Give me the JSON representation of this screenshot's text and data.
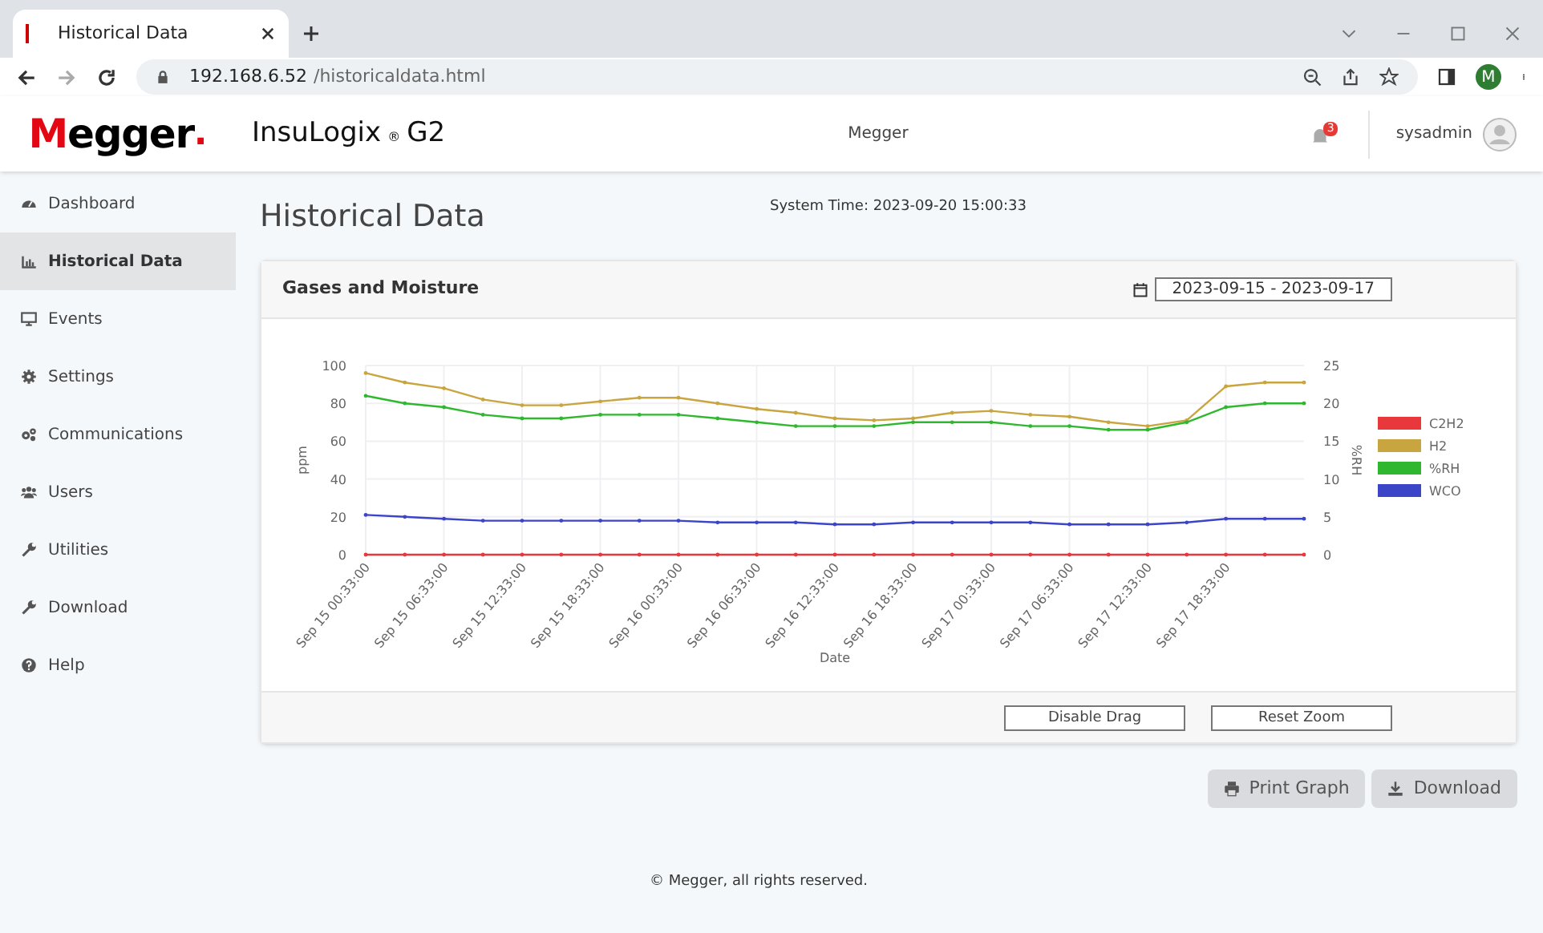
{
  "browser": {
    "tab_title": "Historical Data",
    "url_host": "192.168.6.52",
    "url_path": "/historicaldata.html",
    "profile_initial": "M"
  },
  "header": {
    "logo": "Megger",
    "logo_dot": ".",
    "product": "InsuLogix",
    "product_mark": "®",
    "product_suffix": "G2",
    "center_text": "Megger",
    "notification_count": "3",
    "user": "sysadmin"
  },
  "sidebar": {
    "items": [
      {
        "label": "Dashboard",
        "selected": false
      },
      {
        "label": "Historical Data",
        "selected": true
      },
      {
        "label": "Events",
        "selected": false
      },
      {
        "label": "Settings",
        "selected": false
      },
      {
        "label": "Communications",
        "selected": false
      },
      {
        "label": "Users",
        "selected": false
      },
      {
        "label": "Utilities",
        "selected": false
      },
      {
        "label": "Download",
        "selected": false
      },
      {
        "label": "Help",
        "selected": false
      }
    ]
  },
  "page_title": "Historical Data",
  "system_time": "System Time: 2023-09-20 15:00:33",
  "card": {
    "title": "Gases and Moisture",
    "date_range": "2023-09-15 - 2023-09-17",
    "chart_data": {
      "type": "line",
      "xlabel": "Date",
      "ylabel": "ppm",
      "y2label": "%RH",
      "x": [
        "2023-09-15 00:33",
        "2023-09-15 03:33",
        "2023-09-15 06:33",
        "2023-09-15 09:33",
        "2023-09-15 12:33",
        "2023-09-15 15:33",
        "2023-09-15 18:33",
        "2023-09-15 21:33",
        "2023-09-16 00:33",
        "2023-09-16 03:33",
        "2023-09-16 06:33",
        "2023-09-16 09:33",
        "2023-09-16 12:33",
        "2023-09-16 15:33",
        "2023-09-16 18:33",
        "2023-09-16 21:33",
        "2023-09-17 00:33",
        "2023-09-17 03:33",
        "2023-09-17 06:33",
        "2023-09-17 09:33",
        "2023-09-17 12:33",
        "2023-09-17 15:33",
        "2023-09-17 18:33",
        "2023-09-17 21:33",
        "2023-09-18 00:33"
      ],
      "xticks": [
        {
          "value": "2023-09-15 00:33",
          "label": "Sep 15 00:33:00"
        },
        {
          "value": "2023-09-15 06:33",
          "label": "Sep 15 06:33:00"
        },
        {
          "value": "2023-09-15 12:33",
          "label": "Sep 15 12:33:00"
        },
        {
          "value": "2023-09-15 18:33",
          "label": "Sep 15 18:33:00"
        },
        {
          "value": "2023-09-16 00:33",
          "label": "Sep 16 00:33:00"
        },
        {
          "value": "2023-09-16 06:33",
          "label": "Sep 16 06:33:00"
        },
        {
          "value": "2023-09-16 12:33",
          "label": "Sep 16 12:33:00"
        },
        {
          "value": "2023-09-16 18:33",
          "label": "Sep 16 18:33:00"
        },
        {
          "value": "2023-09-17 00:33",
          "label": "Sep 17 00:33:00"
        },
        {
          "value": "2023-09-17 06:33",
          "label": "Sep 17 06:33:00"
        },
        {
          "value": "2023-09-17 12:33",
          "label": "Sep 17 12:33:00"
        },
        {
          "value": "2023-09-17 18:33",
          "label": "Sep 17 18:33:00"
        }
      ],
      "grid": true,
      "legend": "right",
      "xlim": [
        "2023-09-15 00:33",
        "2023-09-18 00:33"
      ],
      "ylim": [
        0,
        100
      ],
      "yticks": [
        0,
        20,
        40,
        60,
        80,
        100
      ],
      "y2lim": [
        0,
        25
      ],
      "y2ticks": [
        0,
        5,
        10,
        15,
        20,
        25
      ],
      "series": [
        {
          "name": "C2H2",
          "color": "#e8383b",
          "values": [
            0,
            0,
            0,
            0,
            0,
            0,
            0,
            0,
            0,
            0,
            0,
            0,
            0,
            0,
            0,
            0,
            0,
            0,
            0,
            0,
            0,
            0,
            0,
            0,
            0
          ]
        },
        {
          "name": "H2",
          "color": "#c9a53f",
          "values": [
            96,
            91,
            88,
            82,
            79,
            79,
            81,
            83,
            83,
            80,
            77,
            75,
            72,
            71,
            72,
            75,
            76,
            74,
            73,
            70,
            68,
            71,
            89,
            91,
            91
          ]
        },
        {
          "name": "%RH",
          "color": "#2fb82f",
          "axis": "y2",
          "values": [
            21,
            20,
            19.5,
            18.5,
            18,
            18,
            18.5,
            18.5,
            18.5,
            18,
            17.5,
            17,
            17,
            17,
            17.5,
            17.5,
            17.5,
            17,
            17,
            16.5,
            16.5,
            17.5,
            19.5,
            20,
            20
          ]
        },
        {
          "name": "WCO",
          "color": "#3c44c8",
          "values": [
            21,
            20,
            19,
            18,
            18,
            18,
            18,
            18,
            18,
            17,
            17,
            17,
            16,
            16,
            17,
            17,
            17,
            17,
            16,
            16,
            16,
            17,
            19,
            19,
            19
          ]
        }
      ]
    },
    "buttons": [
      "Disable Drag",
      "Reset Zoom"
    ]
  },
  "actions": [
    {
      "label": "Print Graph"
    },
    {
      "label": "Download"
    }
  ],
  "footer": "© Megger, all rights reserved."
}
